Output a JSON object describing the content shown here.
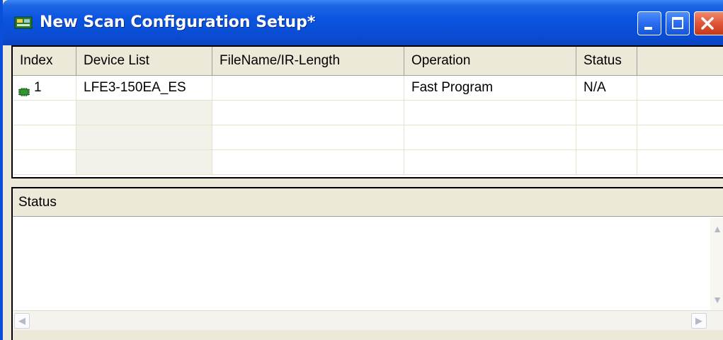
{
  "window": {
    "title": "New Scan Configuration Setup*",
    "app_icon": "chip-board-icon",
    "controls": [
      "minimize-icon",
      "maximize-icon",
      "close-icon"
    ]
  },
  "device_table": {
    "columns": [
      "Index",
      "Device List",
      "FileName/IR-Length",
      "Operation",
      "Status",
      ""
    ],
    "rows": [
      {
        "icon": "chip-icon",
        "index": "1",
        "device": "LFE3-150EA_ES",
        "file": "",
        "operation": "Fast Program",
        "status": "N/A"
      }
    ]
  },
  "status_panel": {
    "title": "Status",
    "scroll_icons": [
      "scroll-up-icon",
      "scroll-down-icon",
      "scroll-left-icon",
      "scroll-right-icon"
    ]
  },
  "colors": {
    "titlebar": "#0b55e0",
    "close_button": "#e0553a",
    "window_bg": "#ece9d8",
    "chip_green": "#2e9a2e"
  }
}
